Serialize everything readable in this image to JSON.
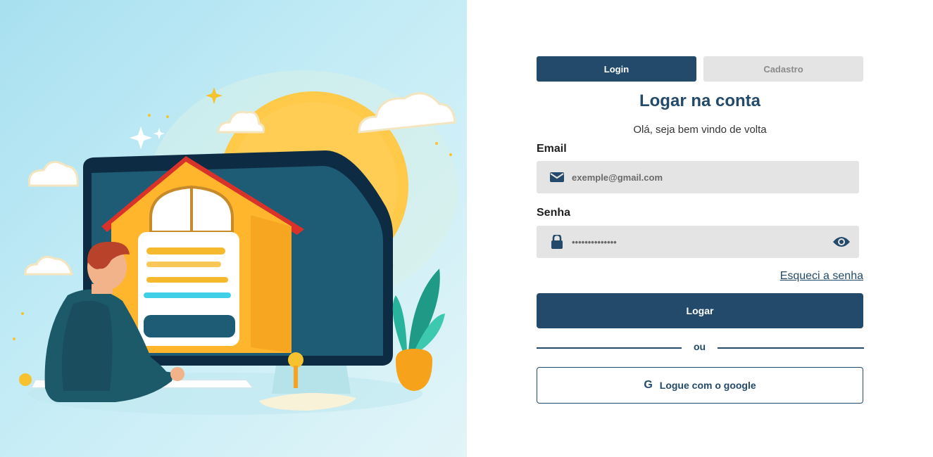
{
  "hero": {
    "illustration": "person-at-computer-with-house-and-login-form",
    "colors": {
      "sky": "#a8e0f0",
      "sun": "#ffc94a",
      "screen": "#1d5c74",
      "roof": "#d8322a",
      "house": "#ffb62c"
    }
  },
  "tabs": [
    {
      "label": "Login",
      "active": true
    },
    {
      "label": "Cadastro",
      "active": false
    }
  ],
  "form": {
    "title": "Logar na conta",
    "subtitle": "Olá, seja bem vindo de volta",
    "email": {
      "label": "Email",
      "placeholder": "exemple@gmail.com",
      "icon": "envelope-icon"
    },
    "password": {
      "label": "Senha",
      "value": "••••••••••••••",
      "icon": "lock-icon",
      "toggle_icon": "eye-icon"
    },
    "forgot_label": "Esqueci a senha",
    "submit_label": "Logar",
    "divider_label": "ou",
    "google_label": "Logue com o google",
    "google_icon": "G"
  },
  "colors": {
    "primary": "#234a6a",
    "field_bg": "#e4e4e4",
    "tab_inactive_bg": "#e4e4e4"
  }
}
